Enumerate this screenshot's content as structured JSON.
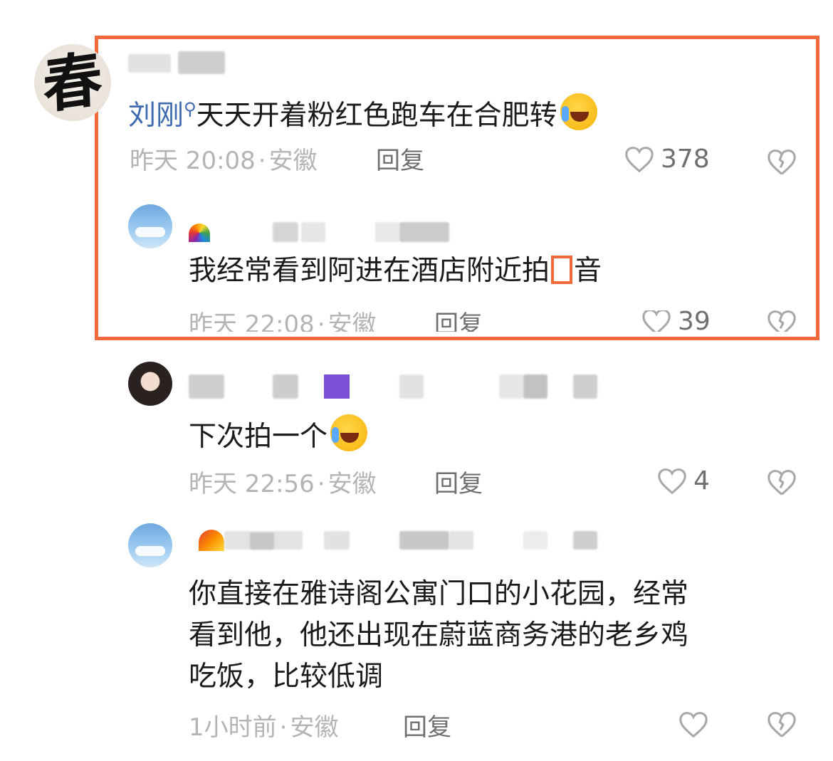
{
  "comments": [
    {
      "avatar_glyph": "春",
      "mention": "刘刚",
      "text": "天天开着粉红色跑车在合肥转",
      "time": "昨天 20:08",
      "location": "安徽",
      "reply": "回复",
      "likes": "378",
      "emoji": "rofl-emoji"
    },
    {
      "text_before": "我经常看到阿进在酒店附近拍",
      "text_after": "音",
      "time": "昨天 22:08",
      "location": "安徽",
      "reply": "回复",
      "likes": "39"
    },
    {
      "text": "下次拍一个",
      "time": "昨天 22:56",
      "location": "安徽",
      "reply": "回复",
      "likes": "4",
      "emoji": "rofl-emoji"
    },
    {
      "lines": [
        "你直接在雅诗阁公寓门口的小花园，经常",
        "看到他，他还出现在蔚蓝商务港的老乡鸡",
        "吃饭，比较低调"
      ],
      "time": "1小时前",
      "location": "安徽",
      "reply": "回复"
    }
  ],
  "meta_separator": "·",
  "colors": {
    "highlight": "#f06a3c",
    "mention": "#3e6ab0"
  }
}
